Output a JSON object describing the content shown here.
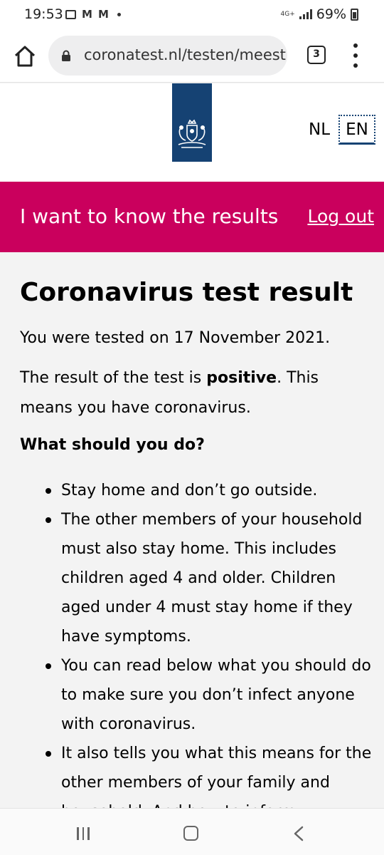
{
  "status_bar": {
    "time": "19:53",
    "network": "4G+",
    "battery": "69%"
  },
  "browser": {
    "url": "coronatest.nl/testen/meest",
    "tab_count": "3"
  },
  "header": {
    "lang_nl": "NL",
    "lang_en": "EN"
  },
  "banner": {
    "title": "I want to know the results",
    "logout": "Log out"
  },
  "main": {
    "title": "Coronavirus test result",
    "tested_on": "You were tested on 17 November 2021.",
    "result_before": "The result of the test is ",
    "result_word": "positive",
    "result_after": ". This means you have coronavirus.",
    "subheading": "What should you do?",
    "items": [
      "Stay home and don’t go outside.",
      "The other members of your household must also stay home. This includes children aged 4 and older. Children aged under 4 must stay home if they have symptoms.",
      "You can read below what you should do to make sure you don’t infect anyone with coronavirus.",
      "It also tells you what this means for the other members of your family and household. And how to inform"
    ]
  },
  "colors": {
    "banner": "#ca005d",
    "logo_blue": "#154273"
  }
}
